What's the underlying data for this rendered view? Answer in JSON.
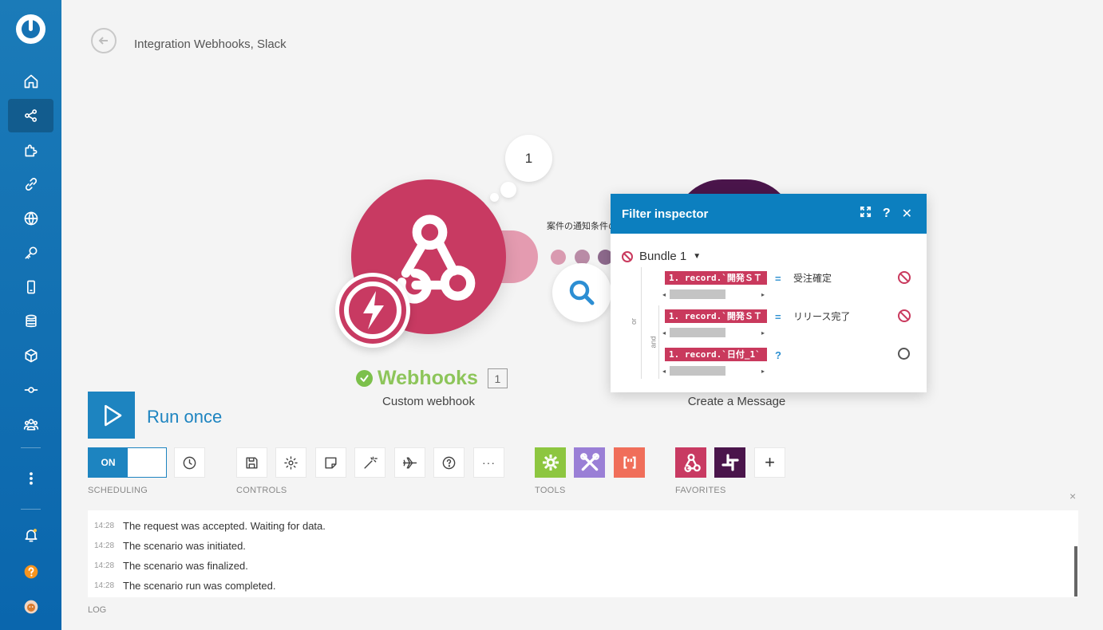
{
  "header": {
    "title": "Integration Webhooks, Slack"
  },
  "canvas": {
    "bubble_count": "1",
    "filter_label": "案件の通知条件の設定",
    "webhook_module": {
      "name": "Webhooks",
      "badge": "1",
      "subtitle": "Custom webhook"
    },
    "slack_module": {
      "subtitle": "Create a Message"
    }
  },
  "filter_inspector": {
    "title": "Filter inspector",
    "bundle_label": "Bundle 1",
    "or_label": "or",
    "and_label": "and",
    "conditions": [
      {
        "field": "1. record.`開発ＳＴ",
        "operator": "=",
        "value": "受注確定",
        "status": "fail"
      },
      {
        "field": "1. record.`開発ＳＴ",
        "operator": "=",
        "value": "リリース完了",
        "status": "fail"
      },
      {
        "field": "1. record.`日付_1`",
        "operator": "?",
        "value": "",
        "status": "unknown"
      }
    ]
  },
  "run": {
    "label": "Run once"
  },
  "toolbar": {
    "toggle_label": "ON",
    "scheduling_label": "SCHEDULING",
    "controls_label": "CONTROLS",
    "tools_label": "TOOLS",
    "favorites_label": "FAVORITES",
    "more_label": "···",
    "add_label": "+"
  },
  "log": {
    "label": "LOG",
    "close": "×",
    "entries": [
      {
        "time": "14:28",
        "message": "The request was accepted. Waiting for data."
      },
      {
        "time": "14:28",
        "message": "The scenario was initiated."
      },
      {
        "time": "14:28",
        "message": "The scenario was finalized."
      },
      {
        "time": "14:28",
        "message": "The scenario run was completed."
      }
    ]
  },
  "colors": {
    "brand_blue": "#1d84c0",
    "webhook_pink": "#c83a62",
    "slack_purple": "#4a154b",
    "success_green": "#8dc55a",
    "tools_green": "#8dc640",
    "tools_purple": "#9a7fd6",
    "tools_orange": "#f06e5a"
  }
}
